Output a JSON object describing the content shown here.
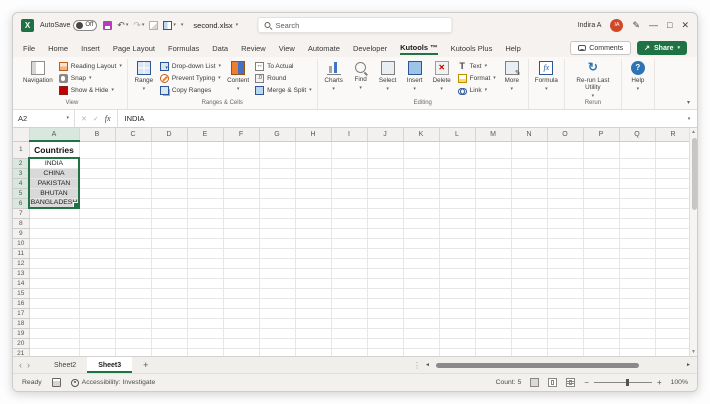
{
  "colors": {
    "accent_green": "#217346",
    "share_green": "#1f7244",
    "selection_fill": "#d9d9d9",
    "avatar_orange": "#d24726"
  },
  "title_bar": {
    "autosave_label": "AutoSave",
    "autosave_state": "Off",
    "filename": "second.xlsx",
    "search_placeholder": "Search",
    "user_name": "Indira A",
    "user_initials": "IA"
  },
  "menu": {
    "tabs": [
      {
        "label": "File"
      },
      {
        "label": "Home"
      },
      {
        "label": "Insert"
      },
      {
        "label": "Page Layout"
      },
      {
        "label": "Formulas"
      },
      {
        "label": "Data"
      },
      {
        "label": "Review"
      },
      {
        "label": "View"
      },
      {
        "label": "Automate"
      },
      {
        "label": "Developer"
      },
      {
        "label": "Kutools ™",
        "active": true
      },
      {
        "label": "Kutools Plus"
      },
      {
        "label": "Help"
      }
    ],
    "comments_label": "Comments",
    "share_label": "Share"
  },
  "ribbon": {
    "groups": [
      {
        "label": "View",
        "items": [
          {
            "t": "big",
            "label": "Navigation",
            "icon": "navigation",
            "caret": false
          },
          {
            "t": "stack",
            "items": [
              {
                "label": "Reading Layout",
                "icon": "reading-layout",
                "caret": true
              },
              {
                "label": "Snap",
                "icon": "snap",
                "caret": true
              },
              {
                "label": "Show & Hide",
                "icon": "show-hide",
                "caret": true
              }
            ]
          }
        ]
      },
      {
        "label": "Ranges & Cells",
        "items": [
          {
            "t": "big",
            "label": "Range",
            "icon": "range",
            "caret": true
          },
          {
            "t": "stack",
            "items": [
              {
                "label": "Drop-down List",
                "icon": "dropdown-list",
                "caret": true
              },
              {
                "label": "Prevent Typing",
                "icon": "prevent-typing",
                "caret": true
              },
              {
                "label": "Copy Ranges",
                "icon": "copy-ranges",
                "caret": false
              }
            ]
          },
          {
            "t": "big",
            "label": "Content",
            "icon": "content",
            "caret": true
          },
          {
            "t": "stack",
            "items": [
              {
                "label": "To Actual",
                "icon": "to-actual",
                "caret": false
              },
              {
                "label": "Round",
                "icon": "round",
                "caret": false
              },
              {
                "label": "Merge & Split",
                "icon": "merge-split",
                "caret": true
              }
            ]
          }
        ]
      },
      {
        "label": "Editing",
        "items": [
          {
            "t": "big",
            "label": "Charts",
            "icon": "charts",
            "caret": true
          },
          {
            "t": "big",
            "label": "Find",
            "icon": "find",
            "caret": true
          },
          {
            "t": "big",
            "label": "Select",
            "icon": "select",
            "caret": true
          },
          {
            "t": "big",
            "label": "Insert",
            "icon": "insert",
            "caret": true
          },
          {
            "t": "big",
            "label": "Delete",
            "icon": "delete",
            "caret": true
          },
          {
            "t": "stack",
            "items": [
              {
                "label": "Text",
                "icon": "text",
                "caret": true
              },
              {
                "label": "Format",
                "icon": "format",
                "caret": true
              },
              {
                "label": "Link",
                "icon": "link",
                "caret": true
              }
            ]
          },
          {
            "t": "big",
            "label": "More",
            "icon": "more",
            "caret": true
          }
        ]
      },
      {
        "label": "",
        "items": [
          {
            "t": "big",
            "label": "Formula",
            "icon": "formula",
            "caret": true
          }
        ]
      },
      {
        "label": "Rerun",
        "items": [
          {
            "t": "big",
            "label": "Re-run Last Utility",
            "icon": "rerun",
            "caret": true
          }
        ]
      },
      {
        "label": "",
        "items": [
          {
            "t": "big",
            "label": "Help",
            "icon": "help",
            "caret": true
          }
        ]
      }
    ]
  },
  "formula_bar": {
    "name_box": "A2",
    "value": "INDIA"
  },
  "grid": {
    "columns": [
      "A",
      "B",
      "C",
      "D",
      "E",
      "F",
      "G",
      "H",
      "I",
      "J",
      "K",
      "L",
      "M",
      "N",
      "O",
      "P",
      "Q",
      "R"
    ],
    "rows": 22,
    "cells": {
      "A1": "Countries",
      "A2": "INDIA",
      "A3": "CHINA",
      "A4": "PAKISTAN",
      "A5": "BHUTAN",
      "A6": "BANGLADESH"
    },
    "selection": {
      "col": "A",
      "from_row": 2,
      "to_row": 6,
      "active_row": 2
    }
  },
  "sheet_tabs": {
    "tabs": [
      {
        "label": "Sheet2"
      },
      {
        "label": "Sheet3",
        "active": true
      }
    ]
  },
  "status_bar": {
    "ready": "Ready",
    "accessibility": "Accessibility: Investigate",
    "count": "Count: 5",
    "zoom": "100%"
  }
}
